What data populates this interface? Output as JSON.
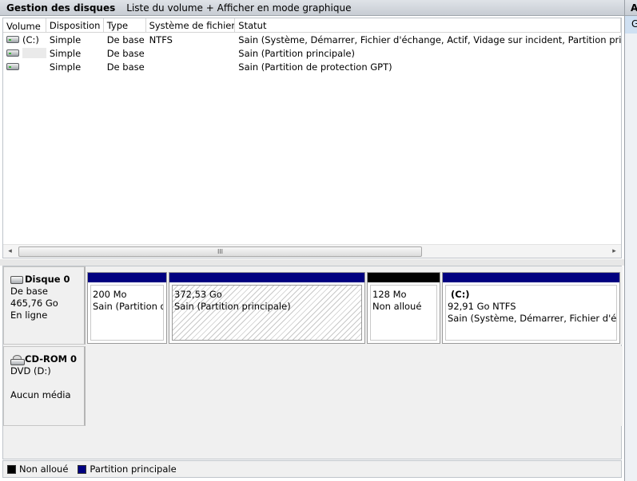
{
  "header": {
    "title": "Gestion des disques",
    "subtitle": "Liste du volume + Afficher en mode graphique"
  },
  "right_panel": {
    "header_text": "A",
    "item_text": "G"
  },
  "volume_list": {
    "columns": [
      "Volume",
      "Disposition",
      "Type",
      "Système de fichiers",
      "Statut"
    ],
    "rows": [
      {
        "volume": "(C:)",
        "disposition": "Simple",
        "type": "De base",
        "fs": "NTFS",
        "status": "Sain (Système, Démarrer, Fichier d'échange, Actif, Vidage sur incident, Partition principale)"
      },
      {
        "volume": "",
        "disposition": "Simple",
        "type": "De base",
        "fs": "",
        "status": "Sain (Partition principale)"
      },
      {
        "volume": "",
        "disposition": "Simple",
        "type": "De base",
        "fs": "",
        "status": "Sain (Partition de protection GPT)"
      }
    ],
    "scroll_grip": "III",
    "scroll_left": "◂",
    "scroll_right": "▸"
  },
  "disks": [
    {
      "name": "Disque 0",
      "kind": "De base",
      "size": "465,76 Go",
      "state": "En ligne",
      "partitions": [
        {
          "volume": "",
          "size": "200 Mo",
          "status": "Sain (Partition de",
          "bar_color": "#000080"
        },
        {
          "volume": "",
          "size": "372,53 Go",
          "status": "Sain (Partition principale)",
          "bar_color": "#000080"
        },
        {
          "volume": "",
          "size": "128 Mo",
          "status": "Non alloué",
          "bar_color": "#000000"
        },
        {
          "volume": "(C:)",
          "size": "92,91 Go NTFS",
          "status": "Sain (Système, Démarrer, Fichier d'écha",
          "bar_color": "#000080"
        }
      ]
    },
    {
      "name": "CD-ROM 0",
      "kind": "DVD (D:)",
      "size": "",
      "state": "Aucun média"
    }
  ],
  "legend": [
    {
      "label": "Non alloué",
      "color": "#000000"
    },
    {
      "label": "Partition principale",
      "color": "#000080"
    }
  ]
}
